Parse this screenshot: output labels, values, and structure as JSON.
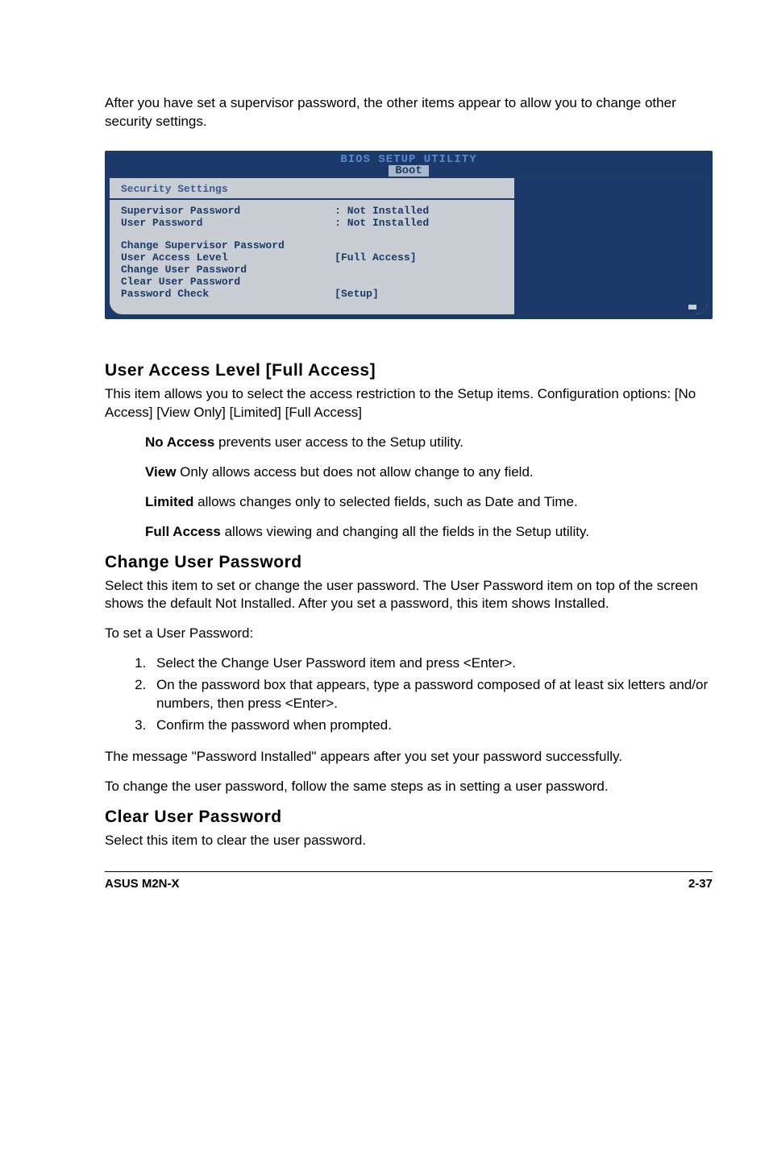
{
  "intro": "After you have set a supervisor password, the other items appear to allow you to change other security settings.",
  "bios": {
    "util_title": "BIOS SETUP UTILITY",
    "tab": "Boot",
    "section_heading": "Security Settings",
    "rows": {
      "sup_label": "Supervisor Password",
      "sup_val": ": Not Installed",
      "user_label": "User Password",
      "user_val": ": Not Installed",
      "csp": "Change Supervisor Password",
      "ual_label": "User Access Level",
      "ual_val": "[Full Access]",
      "cup": "Change User Password",
      "clup": "Clear User Password",
      "pc_label": "Password Check",
      "pc_val": "[Setup]"
    }
  },
  "ual": {
    "heading": "User Access Level [Full Access]",
    "desc": "This item allows you to select the access restriction to the Setup items. Configuration options: [No Access] [View Only] [Limited] [Full Access]",
    "no_access_b": "No Access",
    "no_access_t": " prevents user access to the Setup utility.",
    "view_b": "View",
    "view_t": " Only allows access but does not allow change to any field.",
    "limited_b": "Limited",
    "limited_t": " allows changes only to selected fields, such as Date and Time.",
    "full_b": "Full Access",
    "full_t": " allows viewing and changing all the fields in the Setup utility."
  },
  "cup": {
    "heading": "Change User Password",
    "p1": "Select this item to set or change the user password. The User Password item on top of the screen shows the default Not Installed. After you set a password, this item shows Installed.",
    "p2": "To set a User Password:",
    "steps": [
      "Select the Change User Password item and press <Enter>.",
      "On the password box that appears, type a password composed of at least six letters and/or numbers, then press <Enter>.",
      "Confirm the password when prompted."
    ],
    "p3": "The message \"Password Installed\" appears after you set your password successfully.",
    "p4": "To change the user password, follow the same steps as in setting a user password."
  },
  "clup": {
    "heading": "Clear User Password",
    "p1": "Select this item to clear the user password."
  },
  "footer": {
    "left": "ASUS M2N-X",
    "right": "2-37"
  }
}
